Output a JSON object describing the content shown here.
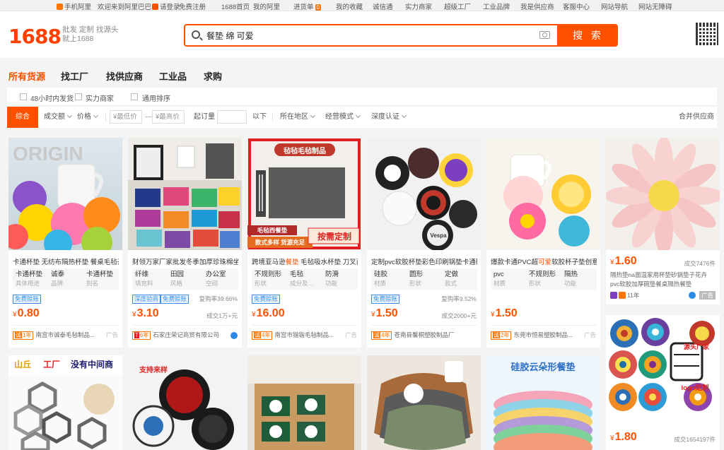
{
  "topbar": {
    "items": [
      "手机阿里",
      "欢迎来到阿里巴巴",
      "请登录",
      "免费注册",
      "1688首页",
      "我的阿里",
      "进货单",
      "我的收藏",
      "诚信通",
      "实力商家",
      "超级工厂",
      "工业品牌",
      "我是供应商",
      "客服中心",
      "网站导航",
      "网站无障碍"
    ],
    "cart_count": "0"
  },
  "header": {
    "logo": "1688",
    "slogan_line1": "批发 定制 找源头",
    "slogan_line2": "就上1688",
    "search_query": "餐垫 绵 可爱",
    "search_button": "搜 索"
  },
  "nav": {
    "tabs": [
      "所有货源",
      "找工厂",
      "找供应商",
      "工业品",
      "求购"
    ]
  },
  "filters": {
    "checks": [
      "48小时内发货",
      "实力商家",
      "通用排序"
    ],
    "sort_comprehensive": "综合",
    "sort_volume": "成交额",
    "sort_price": "价格",
    "min_price": "¥最低价",
    "max_price": "¥最高价",
    "dash": "—",
    "moq": "起订量",
    "below": "以下",
    "region": "所在地区",
    "mode": "经营模式",
    "certify": "深度认证",
    "merge": "合并供应商"
  },
  "colors": {
    "accent": "#ff5000",
    "tag_blue": "#3a8ee6"
  },
  "products": [
    {
      "title": "卡通杯垫 无纺布隔热杯垫 餐桌毛毡茶",
      "attrs": [
        [
          "卡通杯垫",
          "具体用途"
        ],
        [
          "诚泰",
          "品牌"
        ],
        [
          "卡通杯垫",
          "别名"
        ]
      ],
      "tag": "免费赊账",
      "tag2": "",
      "rate": "",
      "price_symbol": "¥",
      "price": "0.80",
      "sold": "",
      "shop_years": "1年",
      "shop": "南宫市诚泰毛毡制品...",
      "ad": "广告"
    },
    {
      "title": "财领万家厂家批发冬季加厚珍珠棉坐",
      "attrs": [
        [
          "纤维",
          "填充料"
        ],
        [
          "田园",
          "风格"
        ],
        [
          "办公室",
          "空间"
        ]
      ],
      "tag": "深度验商",
      "tag2": "免费赊账",
      "rate": "复购率39.66%",
      "price_symbol": "¥",
      "price": "3.10",
      "sold": "成交1万+元",
      "shop_years": "6年",
      "shop": "石家庄荣记商贸有限公司",
      "ad": ""
    },
    {
      "title": "跨境亚马逊餐垫 毛毡吸水杯垫 刀叉西",
      "title_hl": "餐垫",
      "attrs": [
        [
          "不规则形",
          "形状"
        ],
        [
          "毛毡",
          "成分及..."
        ],
        [
          "防滑",
          "功能"
        ]
      ],
      "tag": "免费赊账",
      "tag2": "",
      "rate": "",
      "price_symbol": "¥",
      "price": "16.00",
      "sold": "",
      "shop_years": "4年",
      "shop": "南宫市锴锴毛毡制品...",
      "ad": "广告"
    },
    {
      "title": "定制pvc软胶杯垫彩色印刷锅垫卡通硅",
      "attrs": [
        [
          "硅胶",
          "材质"
        ],
        [
          "圆形",
          "形状"
        ],
        [
          "定做",
          "款式"
        ]
      ],
      "tag": "免费赊账",
      "tag2": "",
      "rate": "复购率9.52%",
      "price_symbol": "¥",
      "price": "1.50",
      "sold": "成交2000+元",
      "shop_years": "4年",
      "shop": "苍南县馨桐塑胶制品厂",
      "ad": ""
    },
    {
      "title": "爆款卡通PVC超可爱软胶杯子垫创意",
      "title_hl": "可爱",
      "attrs": [
        [
          "pvc",
          "材质"
        ],
        [
          "不规则形",
          "形状"
        ],
        [
          "隔热",
          "功能"
        ]
      ],
      "tag": "",
      "tag2": "",
      "rate": "",
      "price_symbol": "¥",
      "price": "1.50",
      "sold": "",
      "shop_years": "2年",
      "shop": "东莞市恒易塑胶制品...",
      "ad": "广告"
    },
    {
      "title": "隔热垫na面温家用杯垫砂锅垫子花卉pvc软胶加厚碗垫餐桌隔热餐垫",
      "price_symbol": "¥",
      "price": "1.60",
      "sold": "成交7476件",
      "years_text": "11年",
      "ad": "广告"
    },
    {
      "price_symbol": "¥",
      "price": "1.80",
      "sold": "成交1654197件"
    }
  ],
  "image_texts": {
    "p3_banner": "毡毡毛毡制品",
    "p3_sub": "毛毡西餐垫",
    "p3_custom": "按需定制",
    "p3_note": "款式多样 货源充足",
    "p4_brand": "Vespa",
    "p7_logo1": "源头厂家",
    "p7_logo2": "logo定制",
    "p8_brand": "山丘",
    "p8_factory": "工厂",
    "p8_slogan": "没有中间商",
    "p9_tag": "支持来样",
    "p12_title": "硅胶云朵形餐垫"
  }
}
